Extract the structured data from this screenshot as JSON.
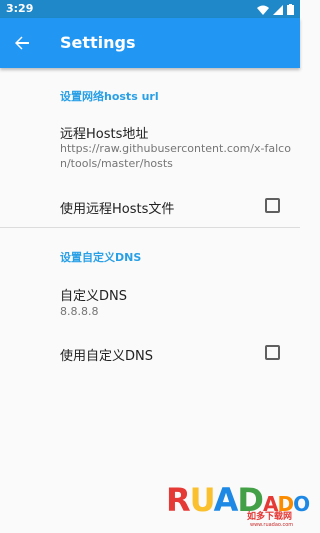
{
  "status_bar": {
    "time": "3:29",
    "icons": [
      "wifi-icon",
      "signal-icon",
      "battery-icon"
    ],
    "color": "#1e88c8"
  },
  "app_bar": {
    "title": "Settings",
    "back_icon": "arrow-left-icon",
    "color": "#2196f3"
  },
  "hosts_category": {
    "title": "设置网络hosts url",
    "remote_hosts": {
      "title": "远程Hosts地址",
      "summary": "https://raw.githubusercontent.com/x-falcon/tools/master/hosts"
    },
    "use_remote_hosts": {
      "title": "使用远程Hosts文件",
      "checked": false
    }
  },
  "dns_category": {
    "title": "设置自定义DNS",
    "custom_dns": {
      "title": "自定义DNS",
      "summary": "8.8.8.8"
    },
    "use_custom_dns": {
      "title": "使用自定义DNS",
      "checked": false
    }
  },
  "watermark": {
    "letters": [
      "R",
      "U",
      "A",
      "D",
      "A",
      "D",
      "O"
    ],
    "colors": [
      "#e53935",
      "#fbc02d",
      "#1e88e5",
      "#43a047",
      "#e53935",
      "#fb8c00",
      "#1e88e5"
    ],
    "tagline": "如多下载网",
    "url": "www.ruadao.com"
  },
  "colors": {
    "accent": "#29a0e6",
    "background": "#fafafa"
  }
}
